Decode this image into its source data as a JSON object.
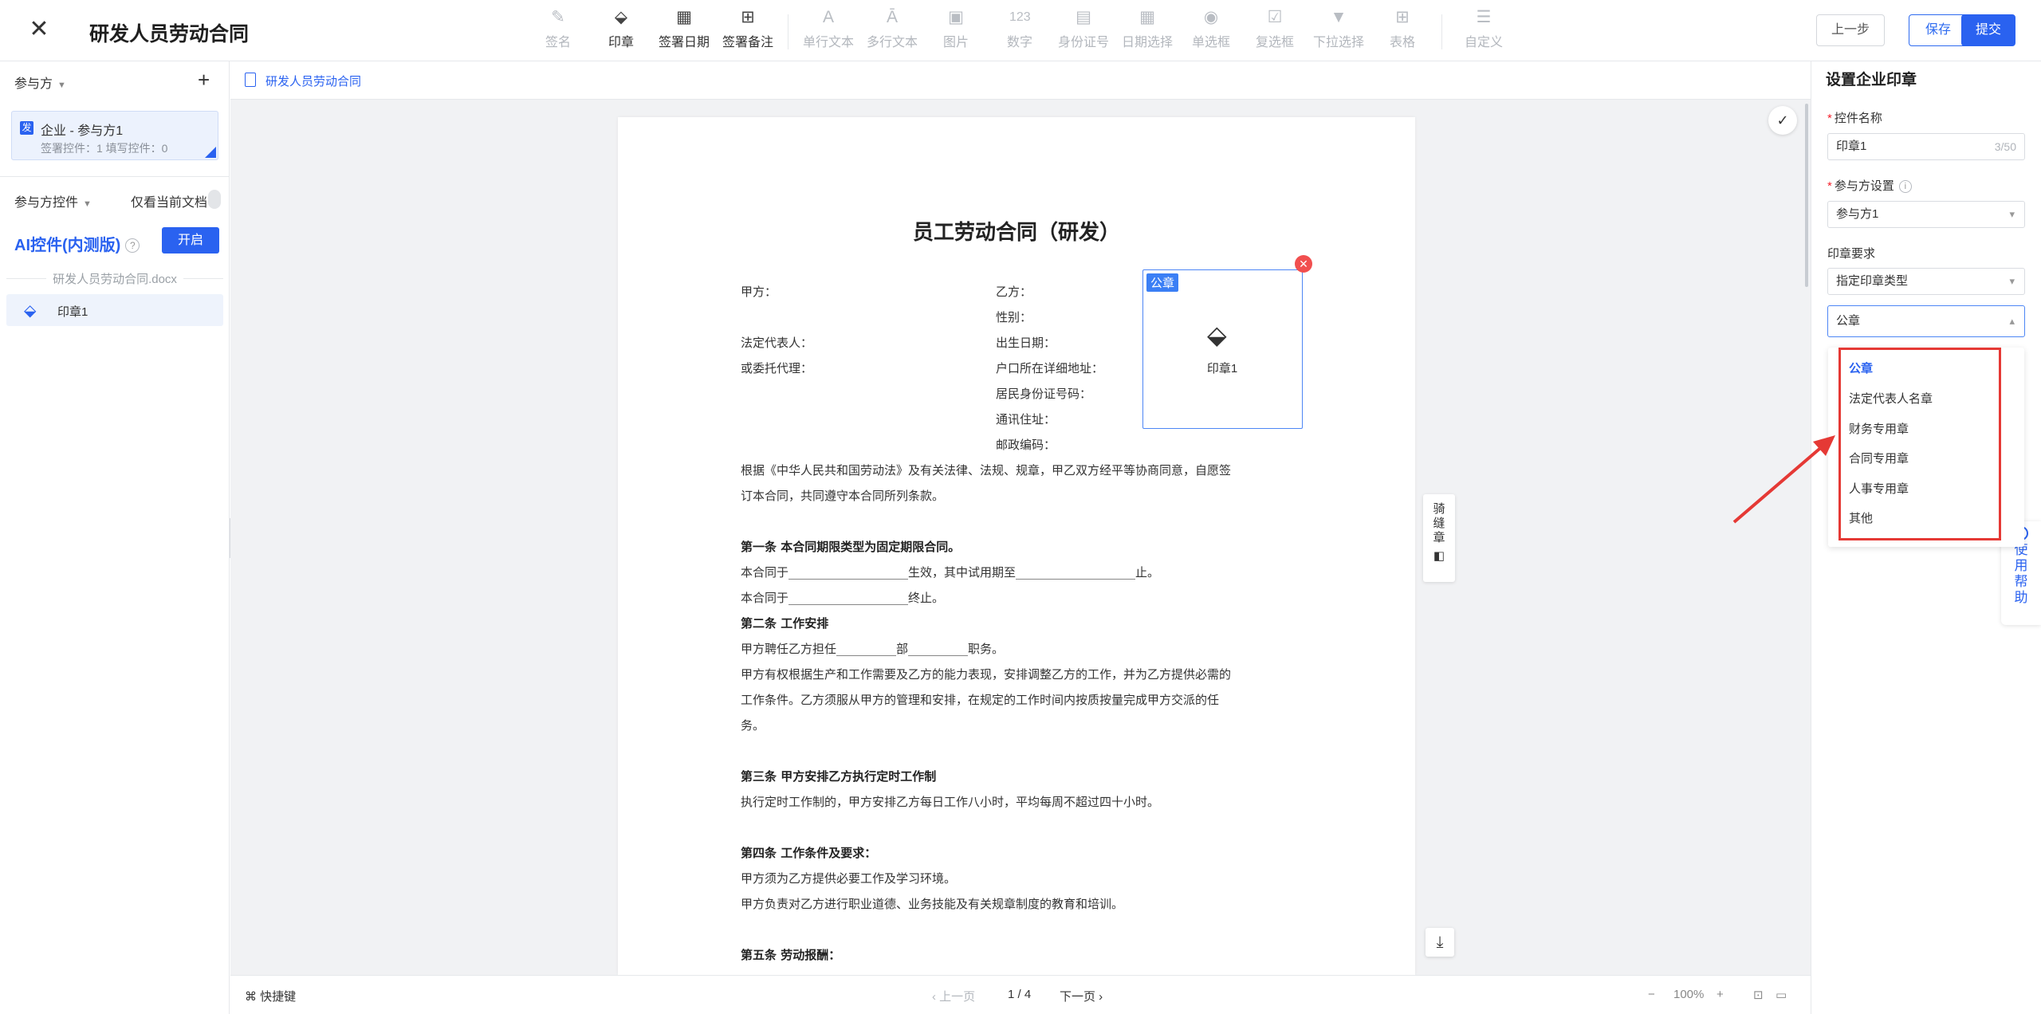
{
  "header": {
    "title": "研发人员劳动合同",
    "buttons": {
      "prev": "上一步",
      "save": "保存",
      "submit": "提交"
    }
  },
  "toolbar": {
    "items": [
      {
        "label": "签名",
        "icon": "pen-icon",
        "enabled": false
      },
      {
        "label": "印章",
        "icon": "stamp-icon",
        "enabled": true
      },
      {
        "label": "签署日期",
        "icon": "calendar-icon",
        "enabled": true
      },
      {
        "label": "签署备注",
        "icon": "note-add-icon",
        "enabled": true
      },
      {
        "label": "单行文本",
        "icon": "text-a-icon",
        "enabled": false
      },
      {
        "label": "多行文本",
        "icon": "multiline-text-icon",
        "enabled": false
      },
      {
        "label": "图片",
        "icon": "image-icon",
        "enabled": false
      },
      {
        "label": "数字",
        "icon": "number-icon",
        "glyph": "123",
        "enabled": false
      },
      {
        "label": "身份证号",
        "icon": "id-card-icon",
        "enabled": false
      },
      {
        "label": "日期选择",
        "icon": "date-picker-icon",
        "enabled": false
      },
      {
        "label": "单选框",
        "icon": "radio-icon",
        "enabled": false
      },
      {
        "label": "复选框",
        "icon": "checkbox-icon",
        "enabled": false
      },
      {
        "label": "下拉选择",
        "icon": "dropdown-icon",
        "enabled": false
      },
      {
        "label": "表格",
        "icon": "table-icon",
        "enabled": false
      },
      {
        "label": "自定义",
        "icon": "custom-settings-icon",
        "enabled": false
      }
    ]
  },
  "left_panel": {
    "participants_title": "参与方",
    "party": {
      "badge": "发",
      "name": "企业 - 参与方1",
      "counts": "签署控件：1    填写控件：0"
    },
    "controls_title": "参与方控件",
    "only_current": "仅看当前文档",
    "ai_label": "AI控件(内测版)",
    "ai_help": "?",
    "ai_button": "开启",
    "file_name": "研发人员劳动合同.docx",
    "control_item": "印章1"
  },
  "file_bar": {
    "name": "研发人员劳动合同"
  },
  "document": {
    "heading": "员工劳动合同（研发）",
    "left_fields": [
      "甲方：",
      "法定代表人：",
      "或委托代理："
    ],
    "right_fields": [
      "乙方：",
      "性别：",
      "出生日期：",
      "户口所在详细地址：",
      "居民身份证号码：",
      "通讯住址：",
      "邮政编码："
    ],
    "body": [
      "根据《中华人民共和国劳动法》及有关法律、法规、规章，甲乙双方经平等协商同意，自愿签",
      "订本合同，共同遵守本合同所列条款。",
      "第一条   本合同期限类型为固定期限合同。",
      "本合同于____________________生效，其中试用期至____________________止。",
      "本合同于____________________终止。",
      "第二条  工作安排",
      "甲方聘任乙方担任__________部__________职务。",
      "甲方有权根据生产和工作需要及乙方的能力表现，安排调整乙方的工作，并为乙方提供必需的",
      "工作条件。乙方须服从甲方的管理和安排，在规定的工作时间内按质按量完成甲方交派的任",
      "务。",
      "第三条  甲方安排乙方执行定时工作制",
      "执行定时工作制的，甲方安排乙方每日工作八小时，平均每周不超过四十小时。",
      "第四条  工作条件及要求：",
      "甲方须为乙方提供必要工作及学习环境。",
      "甲方负责对乙方进行职业道德、业务技能及有关规章制度的教育和培训。",
      "第五条   劳动报酬："
    ]
  },
  "seal_widget": {
    "tag": "公章",
    "label": "印章1"
  },
  "riding_seal": "骑缝章",
  "bottom_bar": {
    "shortcut": "快捷键",
    "prev_page": "上一页",
    "page": "1 / 4",
    "next_page": "下一页",
    "zoom": "100%"
  },
  "right_panel": {
    "title": "设置企业印章",
    "name_label": "控件名称",
    "name_value": "印章1",
    "name_counter": "3/50",
    "party_label": "参与方设置",
    "party_value": "参与方1",
    "req_label": "印章要求",
    "req_value": "指定印章类型",
    "type_value": "公章",
    "options": [
      "公章",
      "法定代表人名章",
      "财务专用章",
      "合同专用章",
      "人事专用章",
      "其他"
    ],
    "selected_option": "公章"
  },
  "help": {
    "text": "使用帮助"
  },
  "colors": {
    "primary": "#2a62f0",
    "annotation_red": "#e53935",
    "delete_red": "#f14f4f"
  }
}
